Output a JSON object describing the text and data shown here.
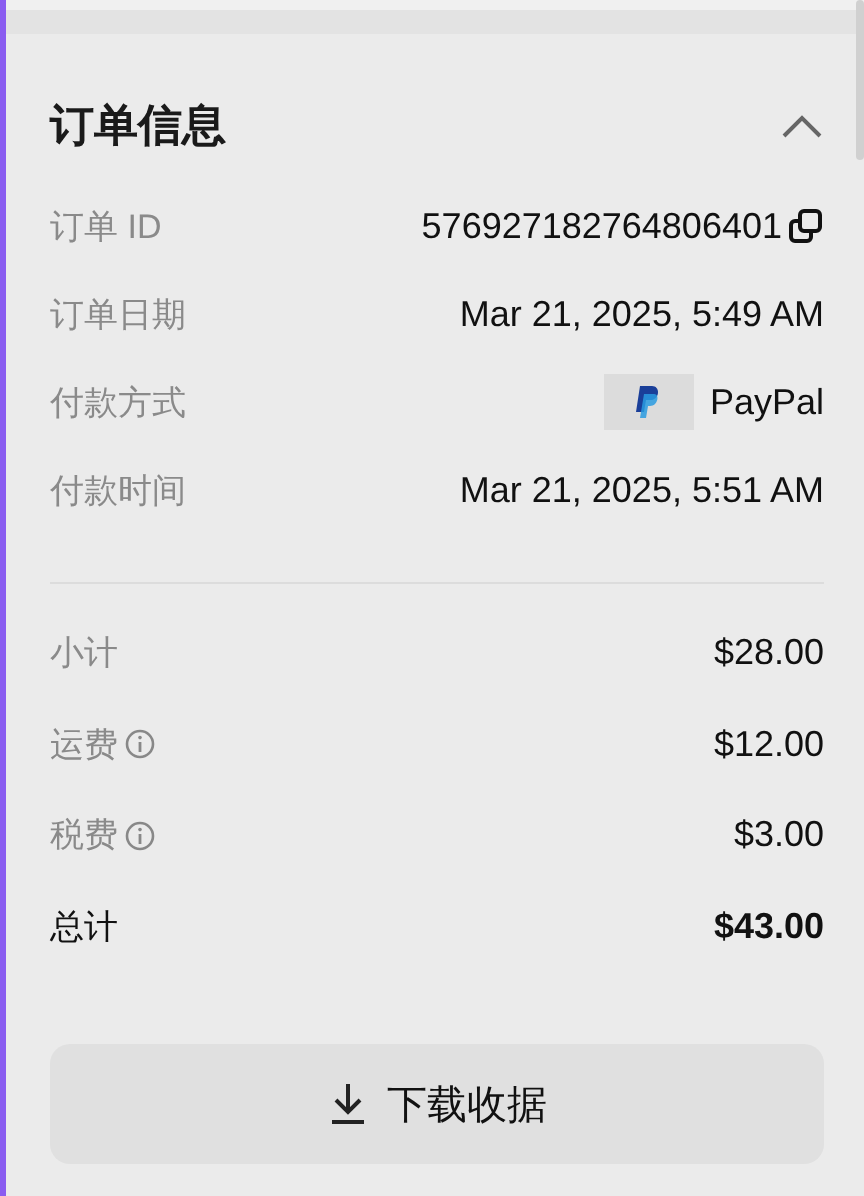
{
  "section": {
    "title": "订单信息",
    "expanded": true
  },
  "details": [
    {
      "kind": "id",
      "label": "订单 ID",
      "value": "576927182764806401",
      "copyable": true
    },
    {
      "kind": "text",
      "label": "订单日期",
      "value": "Mar 21, 2025, 5:49 AM"
    },
    {
      "kind": "payment",
      "label": "付款方式",
      "value": "PayPal"
    },
    {
      "kind": "text",
      "label": "付款时间",
      "value": "Mar 21, 2025, 5:51 AM"
    }
  ],
  "summary": [
    {
      "kind": "line",
      "label": "小计",
      "value": "$28.00",
      "info": false
    },
    {
      "kind": "line",
      "label": "运费",
      "value": "$12.00",
      "info": true
    },
    {
      "kind": "line",
      "label": "税费",
      "value": "$3.00",
      "info": true
    },
    {
      "kind": "total",
      "label": "总计",
      "value": "$43.00",
      "info": false
    }
  ],
  "button": {
    "label": "下载收据"
  }
}
